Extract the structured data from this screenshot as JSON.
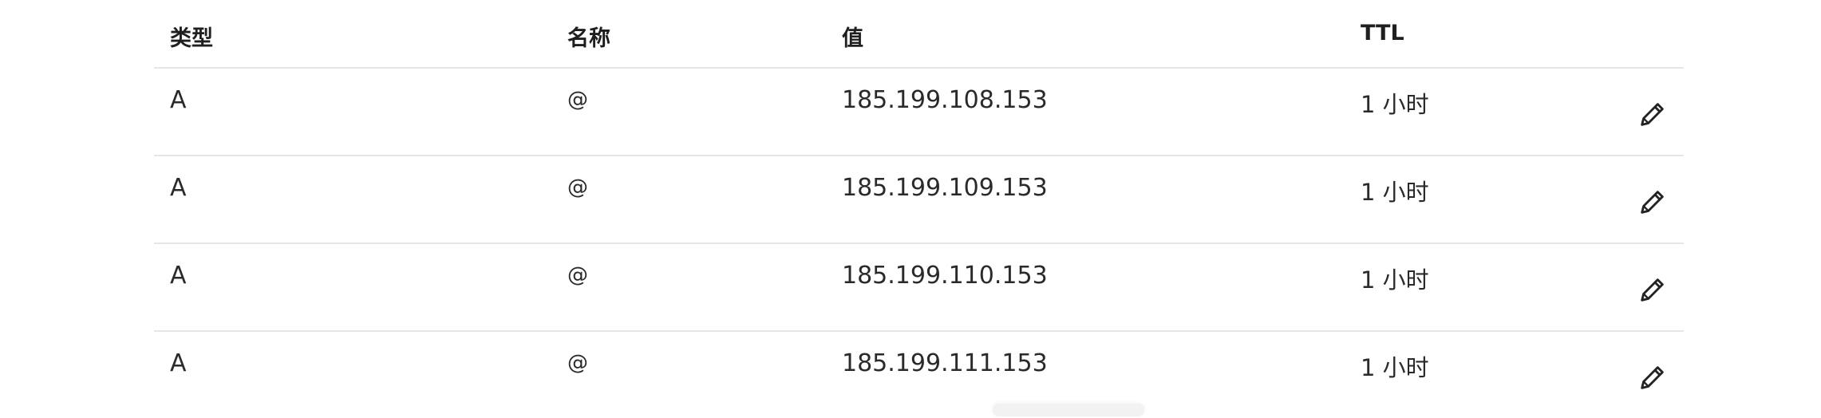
{
  "table": {
    "headers": {
      "type": "类型",
      "name": "名称",
      "value": "值",
      "ttl": "TTL"
    },
    "rows": [
      {
        "type": "A",
        "name": "@",
        "value": "185.199.108.153",
        "ttl": "1 小时",
        "action_icon": "pencil-icon"
      },
      {
        "type": "A",
        "name": "@",
        "value": "185.199.109.153",
        "ttl": "1 小时",
        "action_icon": "pencil-icon"
      },
      {
        "type": "A",
        "name": "@",
        "value": "185.199.110.153",
        "ttl": "1 小时",
        "action_icon": "pencil-icon"
      },
      {
        "type": "A",
        "name": "@",
        "value": "185.199.111.153",
        "ttl": "1 小时",
        "action_icon": "pencil-icon"
      }
    ]
  }
}
